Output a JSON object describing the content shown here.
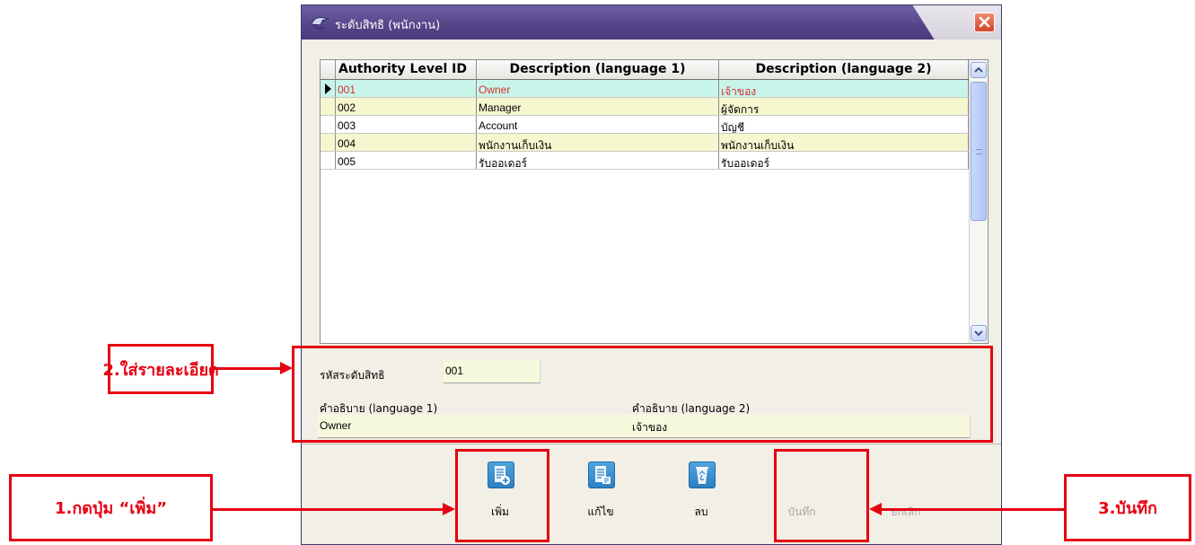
{
  "window": {
    "title": "ระดับสิทธิ (พนักงาน)",
    "close_label": "✕"
  },
  "grid": {
    "columns": [
      "Authority Level ID",
      "Description (language 1)",
      "Description (language 2)"
    ],
    "rows": [
      {
        "id": "001",
        "desc1": "Owner",
        "desc2": "เจ้าของ"
      },
      {
        "id": "002",
        "desc1": "Manager",
        "desc2": "ผู้จัดการ"
      },
      {
        "id": "003",
        "desc1": "Account",
        "desc2": "บัญชี"
      },
      {
        "id": "004",
        "desc1": "พนักงานเก็บเงิน",
        "desc2": "พนักงานเก็บเงิน"
      },
      {
        "id": "005",
        "desc1": "รับออเดอร์",
        "desc2": "รับออเดอร์"
      }
    ],
    "selected_row": 0
  },
  "form": {
    "code_label": "รหัสระดับสิทธิ",
    "code_value": "001",
    "desc1_label": "คำอธิบาย (language 1)",
    "desc1_value": "Owner",
    "desc2_label": "คำอธิบาย (language 2)",
    "desc2_value": "เจ้าของ"
  },
  "toolbar": {
    "add_label": "เพิ่ม",
    "edit_label": "แก้ไข",
    "delete_label": "ลบ",
    "save_label": "บันทึก",
    "cancel_label": "ยกเลิก"
  },
  "annotations": {
    "step1": "1.กดปุ่ม “เพิ่ม”",
    "step2": "2.ใส่รายละเอียด",
    "step3": "3.บันทึก"
  },
  "colors": {
    "annotation_red": "#e60012",
    "selected_row_bg": "#c9f4ea",
    "alt_row_bg": "#f5f7cf",
    "title_bar": "#554487"
  }
}
